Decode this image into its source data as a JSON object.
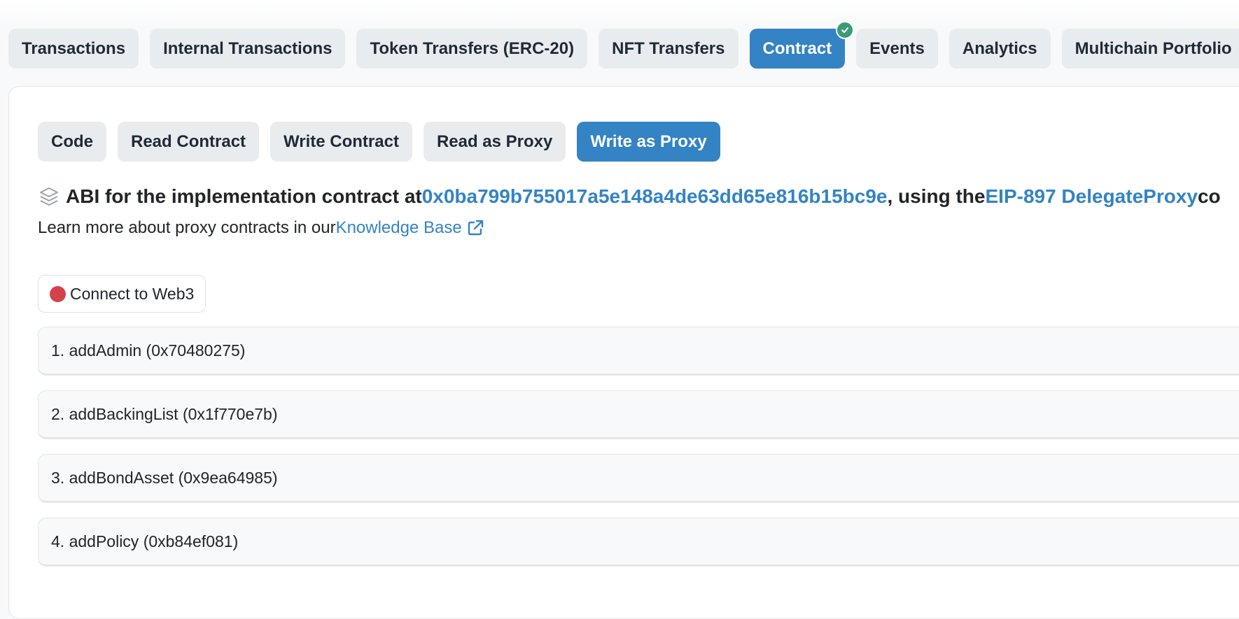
{
  "main_tabs": [
    {
      "label": "Transactions"
    },
    {
      "label": "Internal Transactions"
    },
    {
      "label": "Token Transfers (ERC-20)"
    },
    {
      "label": "NFT Transfers"
    },
    {
      "label": "Contract"
    },
    {
      "label": "Events"
    },
    {
      "label": "Analytics"
    },
    {
      "label": "Multichain Portfolio"
    }
  ],
  "active_main_tab": "Contract",
  "contract_sub_tabs": [
    {
      "label": "Code"
    },
    {
      "label": "Read Contract"
    },
    {
      "label": "Write Contract"
    },
    {
      "label": "Read as Proxy"
    },
    {
      "label": "Write as Proxy"
    }
  ],
  "active_sub_tab": "Write as Proxy",
  "abi_info": {
    "prefix": "ABI for the implementation contract at ",
    "address": "0x0ba799b755017a5e148a4de63dd65e816b15bc9e",
    "middle": ", using the ",
    "pattern": "EIP-897 DelegateProxy",
    "suffix": " co"
  },
  "learn_more": {
    "text": "Learn more about proxy contracts in our ",
    "link": "Knowledge Base"
  },
  "connect_button": {
    "label": "Connect to Web3",
    "status_color": "#d3424a"
  },
  "functions": [
    {
      "label": "1. addAdmin (0x70480275)"
    },
    {
      "label": "2. addBackingList (0x1f770e7b)"
    },
    {
      "label": "3. addBondAsset (0x9ea64985)"
    },
    {
      "label": "4. addPolicy (0xb84ef081)"
    }
  ],
  "colors": {
    "accent": "#3483c4",
    "verified_badge": "#3a9c76",
    "tab_bg": "#e9ecef"
  },
  "icons": {
    "abi": "layers-icon",
    "external": "external-link-icon",
    "verified": "check-circle-icon"
  }
}
